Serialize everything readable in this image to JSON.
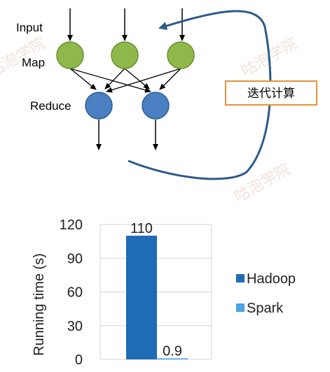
{
  "diagram": {
    "labels": {
      "input": "Input",
      "map": "Map",
      "reduce": "Reduce"
    },
    "iteration_label": "迭代计算",
    "colors": {
      "map_fill": "#8fb84a",
      "map_stroke": "#6a8f2e",
      "reduce_fill": "#4a7fc1",
      "reduce_stroke": "#2f5f9c",
      "loop": "#2e5a8a",
      "label_border": "#e8913a"
    }
  },
  "watermark": "咕泡学院",
  "chart_data": {
    "type": "bar",
    "ylabel": "Running time (s)",
    "yticks": [
      0,
      30,
      60,
      90,
      120
    ],
    "ylim": [
      0,
      120
    ],
    "categories": [
      "Hadoop",
      "Spark"
    ],
    "values": [
      110,
      0.9
    ],
    "data_labels": [
      "110",
      "0.9"
    ],
    "legend": [
      {
        "name": "Hadoop",
        "color": "#1f6bb5"
      },
      {
        "name": "Spark",
        "color": "#4aa3e6"
      }
    ],
    "legend_placement": "right",
    "grid": true
  }
}
